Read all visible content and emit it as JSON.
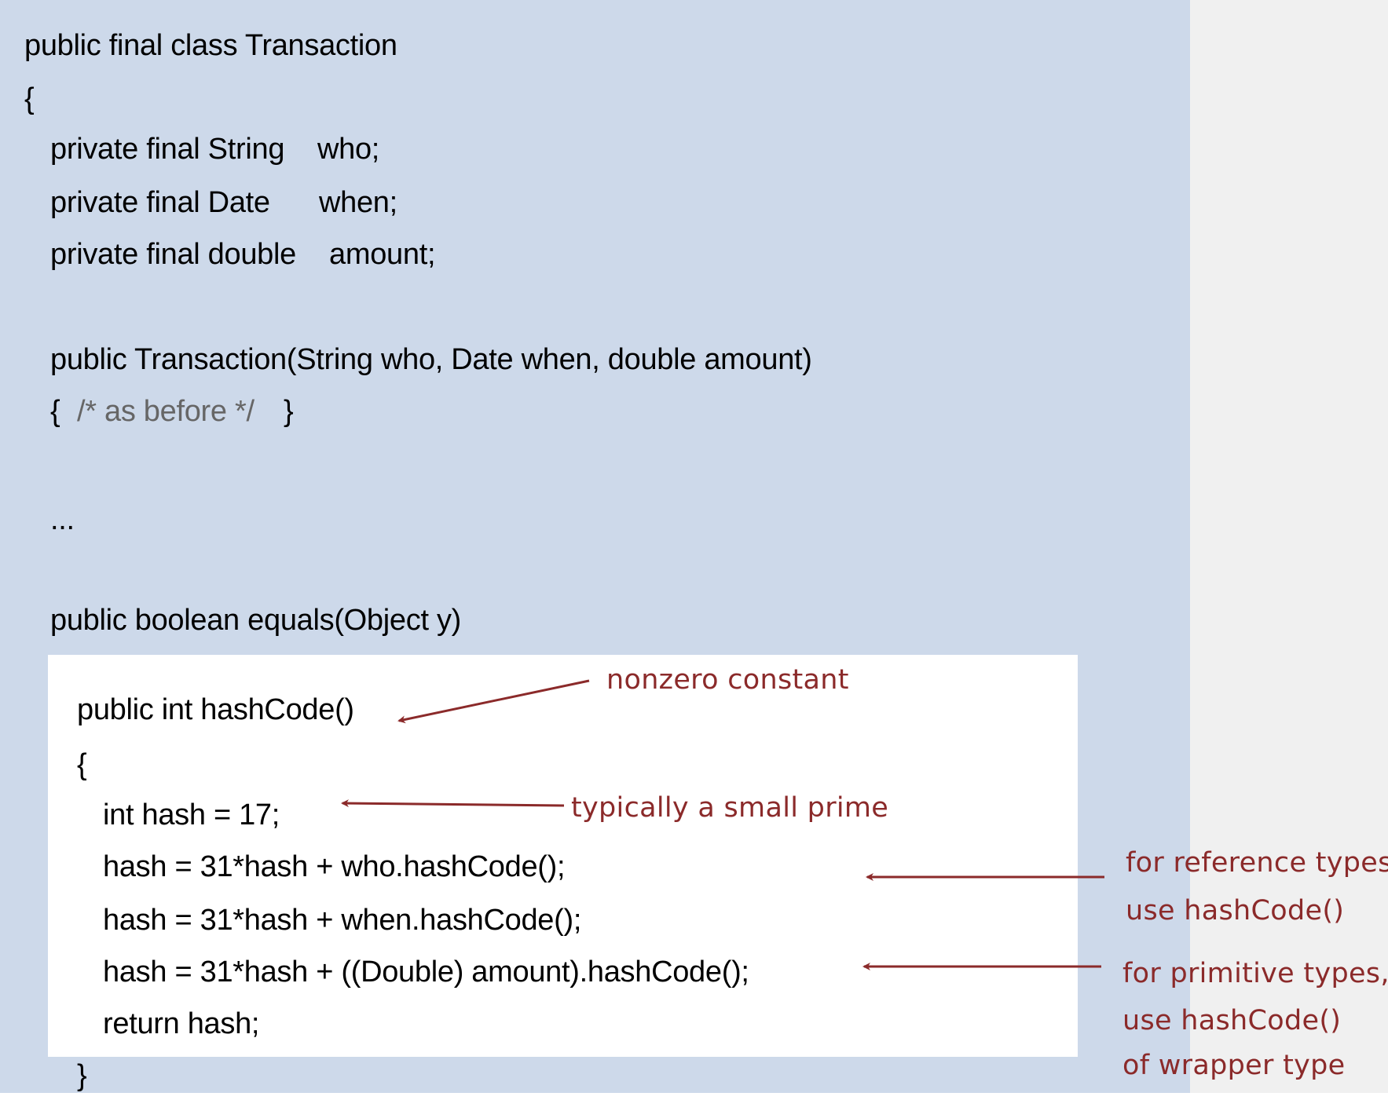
{
  "code": {
    "class_decl": "public final class Transaction",
    "open_brace": "{",
    "field_who_type": "private final String",
    "field_who_name": "who;",
    "field_when_type": "private final Date",
    "field_when_name": "when;",
    "field_amount_type": "private final double",
    "field_amount_name": "amount;",
    "constructor": "public Transaction(String who, Date when, double amount)",
    "ctor_body_open": "{",
    "ctor_comment": "/* as before */",
    "ctor_body_close": "}",
    "ellipsis": "...",
    "equals_decl": "public boolean equals(Object y)",
    "hash_decl": "public int hashCode()",
    "hash_open": "{",
    "hash_init": "int hash = 17;",
    "hash_who": "hash = 31*hash + who.hashCode();",
    "hash_when": "hash = 31*hash + when.hashCode();",
    "hash_amount": "hash = 31*hash + ((Double) amount).hashCode();",
    "hash_return": "return hash;",
    "hash_close": "}"
  },
  "annotations": {
    "nonzero": "nonzero constant",
    "prime": "typically a small prime",
    "ref_line1": "for reference types,",
    "ref_line2": "use hashCode()",
    "prim_line1": "for primitive types,",
    "prim_line2": "use hashCode()",
    "prim_line3": "of wrapper type"
  },
  "colors": {
    "panel": "#cdd9ea",
    "annotation": "#8b2a2a"
  }
}
